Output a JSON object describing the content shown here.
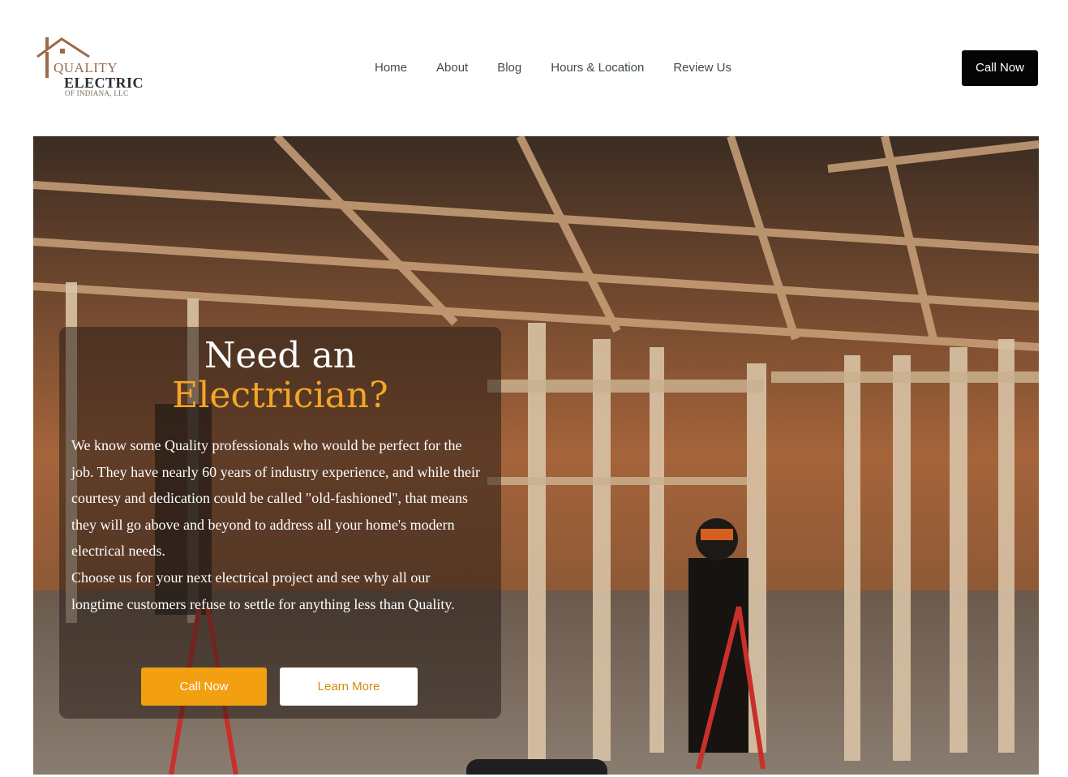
{
  "brand": {
    "line1": "QUALITY",
    "line2": "ELECTRIC",
    "line3": "OF INDIANA, LLC"
  },
  "nav": {
    "items": [
      "Home",
      "About",
      "Blog",
      "Hours & Location",
      "Review Us"
    ]
  },
  "header": {
    "call_label": "Call Now"
  },
  "hero": {
    "heading_line1": "Need an",
    "heading_line2": "Electrician?",
    "paragraph1": "We know some Quality professionals who would be perfect for the job. They have nearly 60 years of industry experience, and while their courtesy and dedication could be called \"old-fashioned\", that means they will go above and beyond to address all your home's modern electrical needs.",
    "paragraph2": "Choose us for your next electrical project and see why all our longtime customers refuse to settle for anything less than Quality.",
    "call_label": "Call Now",
    "learn_label": "Learn More"
  },
  "colors": {
    "accent": "#f29f12",
    "heading_accent": "#f3a625",
    "top_button_bg": "#050505",
    "nav_text": "#3f4a52"
  }
}
